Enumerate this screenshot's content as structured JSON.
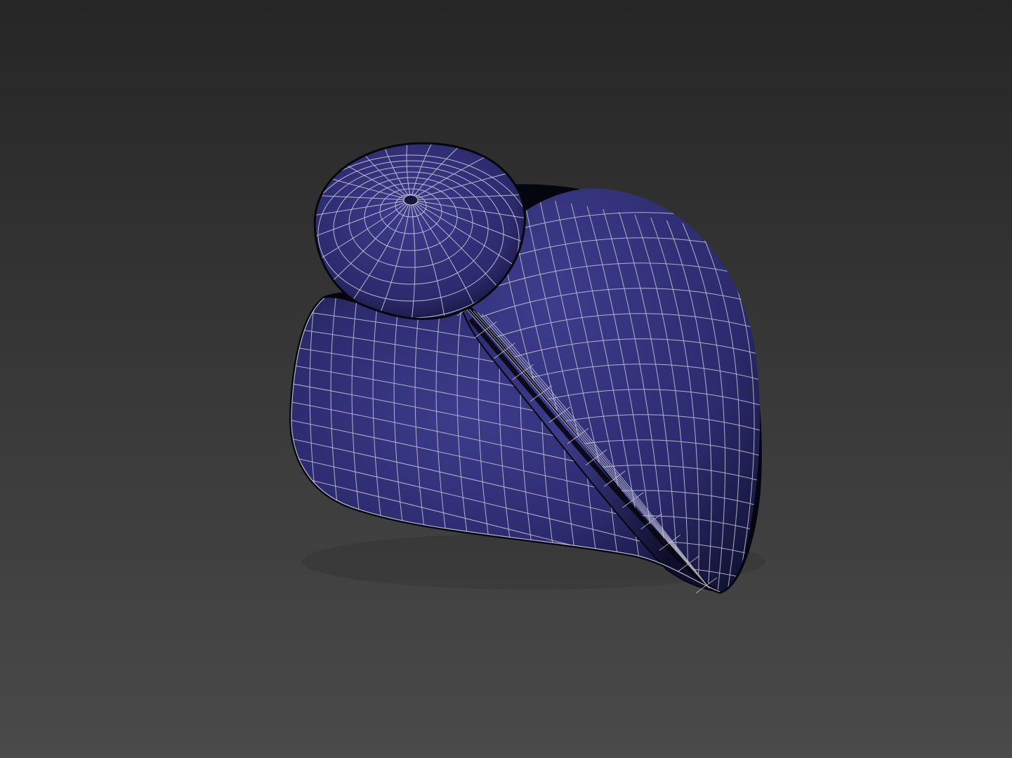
{
  "viewport": {
    "background_top": "#262626",
    "background_bottom": "#4a4a4a",
    "shading_mode": "shaded-with-wireframe"
  },
  "model": {
    "object": "turban",
    "parts": [
      "crown-knot",
      "turban-body",
      "diagonal-band"
    ],
    "colors": {
      "base": "#2c2b6e",
      "highlight": "#3d3c8c",
      "shadow": "#0e0e2a",
      "wire": "#c8c8d8",
      "outline": "#050510"
    }
  }
}
